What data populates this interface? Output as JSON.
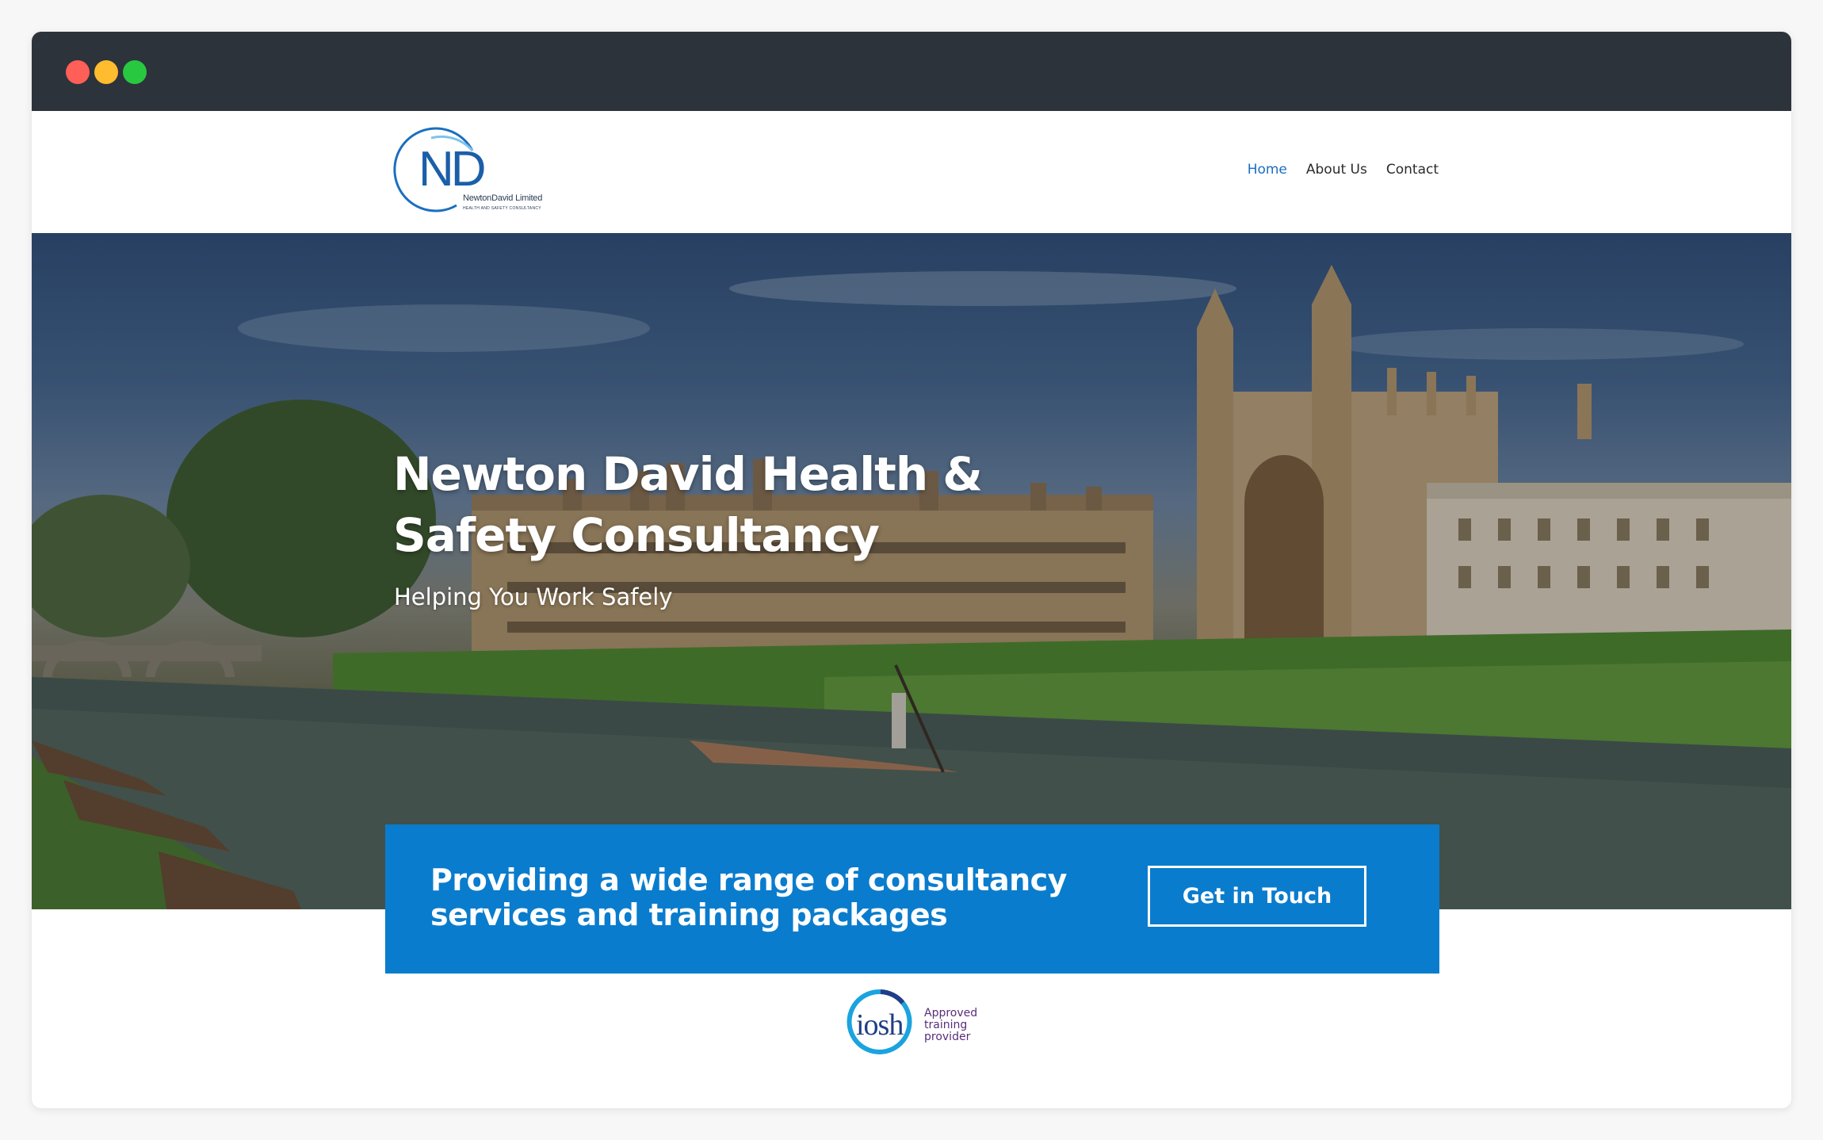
{
  "window": {
    "traffic_lights": [
      "close",
      "minimize",
      "zoom"
    ]
  },
  "header": {
    "logo": {
      "monogram": "ND",
      "caption": "NewtonDavid Limited",
      "tagline": "HEALTH AND SAFETY CONSULTANCY"
    },
    "nav": [
      {
        "label": "Home",
        "active": true
      },
      {
        "label": "About Us",
        "active": false
      },
      {
        "label": "Contact",
        "active": false
      }
    ]
  },
  "hero": {
    "title": "Newton David Health & Safety Consultancy",
    "subtitle": "Helping You Work Safely"
  },
  "cta": {
    "text": "Providing a wide range of consultancy services and training packages",
    "button_label": "Get in Touch"
  },
  "accreditation": {
    "word": "iosh",
    "tagline": "Approved training provider"
  },
  "colors": {
    "accent": "#0a7ccd",
    "nav_active": "#1a6fc0",
    "titlebar": "#2d333b"
  }
}
